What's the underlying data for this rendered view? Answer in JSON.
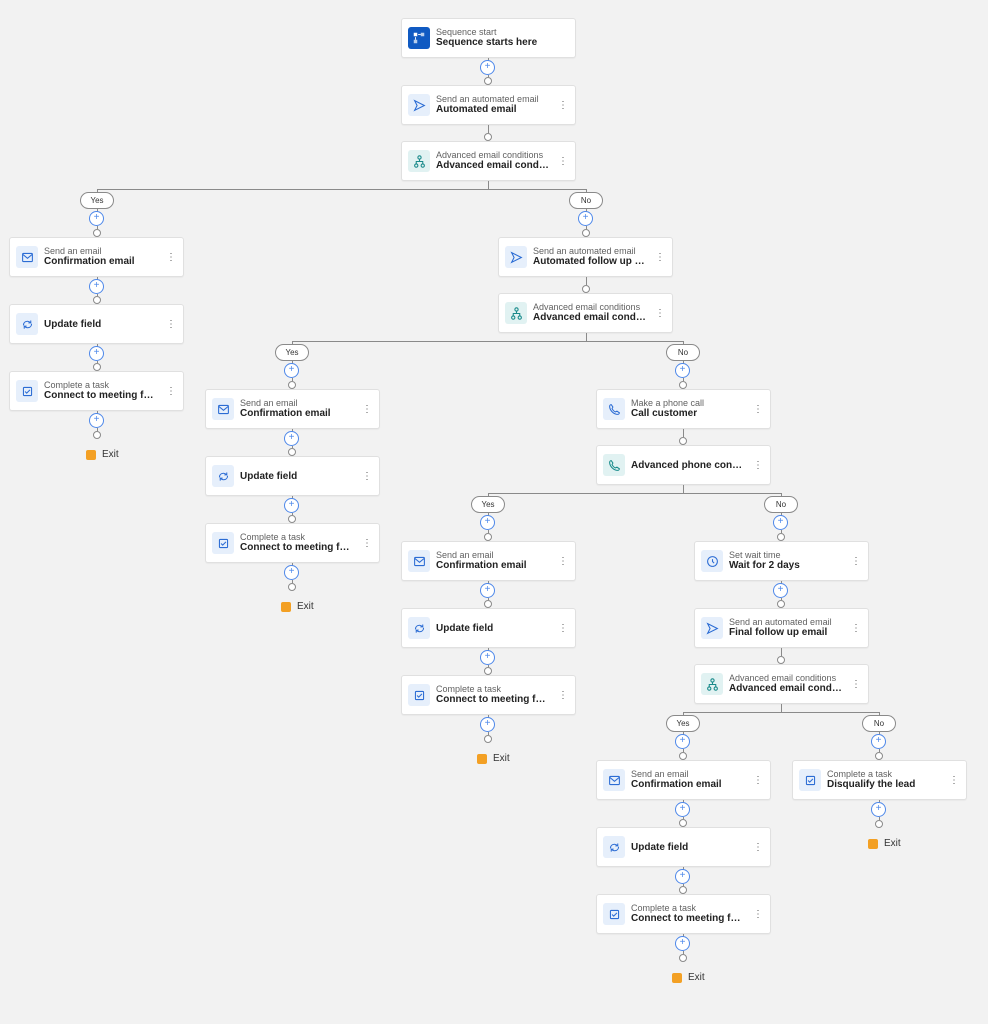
{
  "labels": {
    "yes": "Yes",
    "no": "No",
    "exit": "Exit"
  },
  "types": {
    "sequence_start": "Sequence start",
    "send_automated_email": "Send an automated email",
    "advanced_email_conditions": "Advanced email conditions",
    "send_email": "Send an email",
    "update_field": "Update field",
    "complete_task": "Complete a task",
    "make_phone_call": "Make a phone call",
    "advanced_phone_condition": "Advanced phone condition",
    "set_wait_time": "Set wait time"
  },
  "titles": {
    "sequence_starts_here": "Sequence starts here",
    "automated_email": "Automated email",
    "adv_email_cond": "Advanced email conditions",
    "confirmation_email": "Confirmation email",
    "update_field": "Update field",
    "connect_meeting": "Connect to meeting for product demo r...",
    "automated_followup": "Automated follow up email",
    "call_customer": "Call customer",
    "adv_phone_cond": "Advanced phone condition",
    "wait_2_days": "Wait for 2 days",
    "final_followup": "Final follow up email",
    "disqualify_lead": "Disqualify the lead"
  }
}
